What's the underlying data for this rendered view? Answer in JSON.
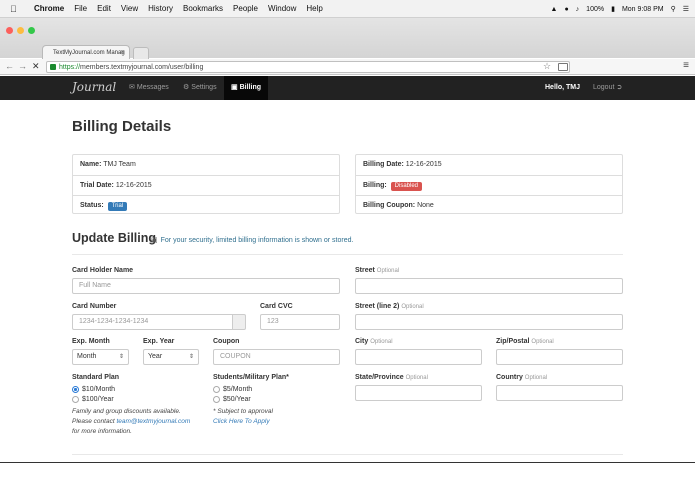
{
  "menubar": {
    "app": "Chrome",
    "items": [
      "File",
      "Edit",
      "View",
      "History",
      "Bookmarks",
      "People",
      "Window",
      "Help"
    ],
    "battery": "100%",
    "clock": "Mon 9:08 PM"
  },
  "browser": {
    "tab_title": "TextMyJournal.com Manag",
    "url_scheme": "https://",
    "url_rest": "members.textmyjournal.com/user/billing"
  },
  "navbar": {
    "logo": "Journal",
    "messages": "Messages",
    "settings": "Settings",
    "billing": "Billing",
    "user": "Hello, TMJ",
    "logout": "Logout"
  },
  "page": {
    "title": "Billing Details",
    "details_left": [
      {
        "label": "Name:",
        "value": "TMJ Team"
      },
      {
        "label": "Trial Date:",
        "value": "12-16-2015"
      },
      {
        "label": "Status:",
        "badge": "Trial"
      }
    ],
    "details_right": [
      {
        "label": "Billing Date:",
        "value": "12-16-2015"
      },
      {
        "label": "Billing:",
        "badge": "Disabled"
      },
      {
        "label": "Billing Coupon:",
        "value": "None"
      }
    ],
    "update_title": "Update Billing",
    "update_note": "For your security, limited billing information is shown or stored."
  },
  "form": {
    "card_holder_label": "Card Holder Name",
    "card_holder_placeholder": "Full Name",
    "card_number_label": "Card Number",
    "card_number_placeholder": "1234-1234-1234-1234",
    "cvc_label": "Card CVC",
    "cvc_placeholder": "123",
    "exp_month_label": "Exp. Month",
    "exp_month_value": "Month",
    "exp_year_label": "Exp. Year",
    "exp_year_value": "Year",
    "coupon_label": "Coupon",
    "coupon_placeholder": "COUPON",
    "street_label": "Street",
    "street2_label": "Street (line 2)",
    "city_label": "City",
    "zip_label": "Zip/Postal",
    "state_label": "State/Province",
    "country_label": "Country",
    "optional": "Optional",
    "standard_plan_label": "Standard Plan",
    "standard_options": [
      "$10/Month",
      "$100/Year"
    ],
    "student_plan_label": "Students/Military Plan*",
    "student_options": [
      "$5/Month",
      "$50/Year"
    ],
    "family_note_1": "Family and group discounts available.",
    "family_note_2": "Please contact",
    "family_email": "team@textmyjournal.com",
    "family_note_3": "for more information.",
    "approval_note": "* Subject to approval",
    "apply_link": "Click Here To Apply"
  }
}
